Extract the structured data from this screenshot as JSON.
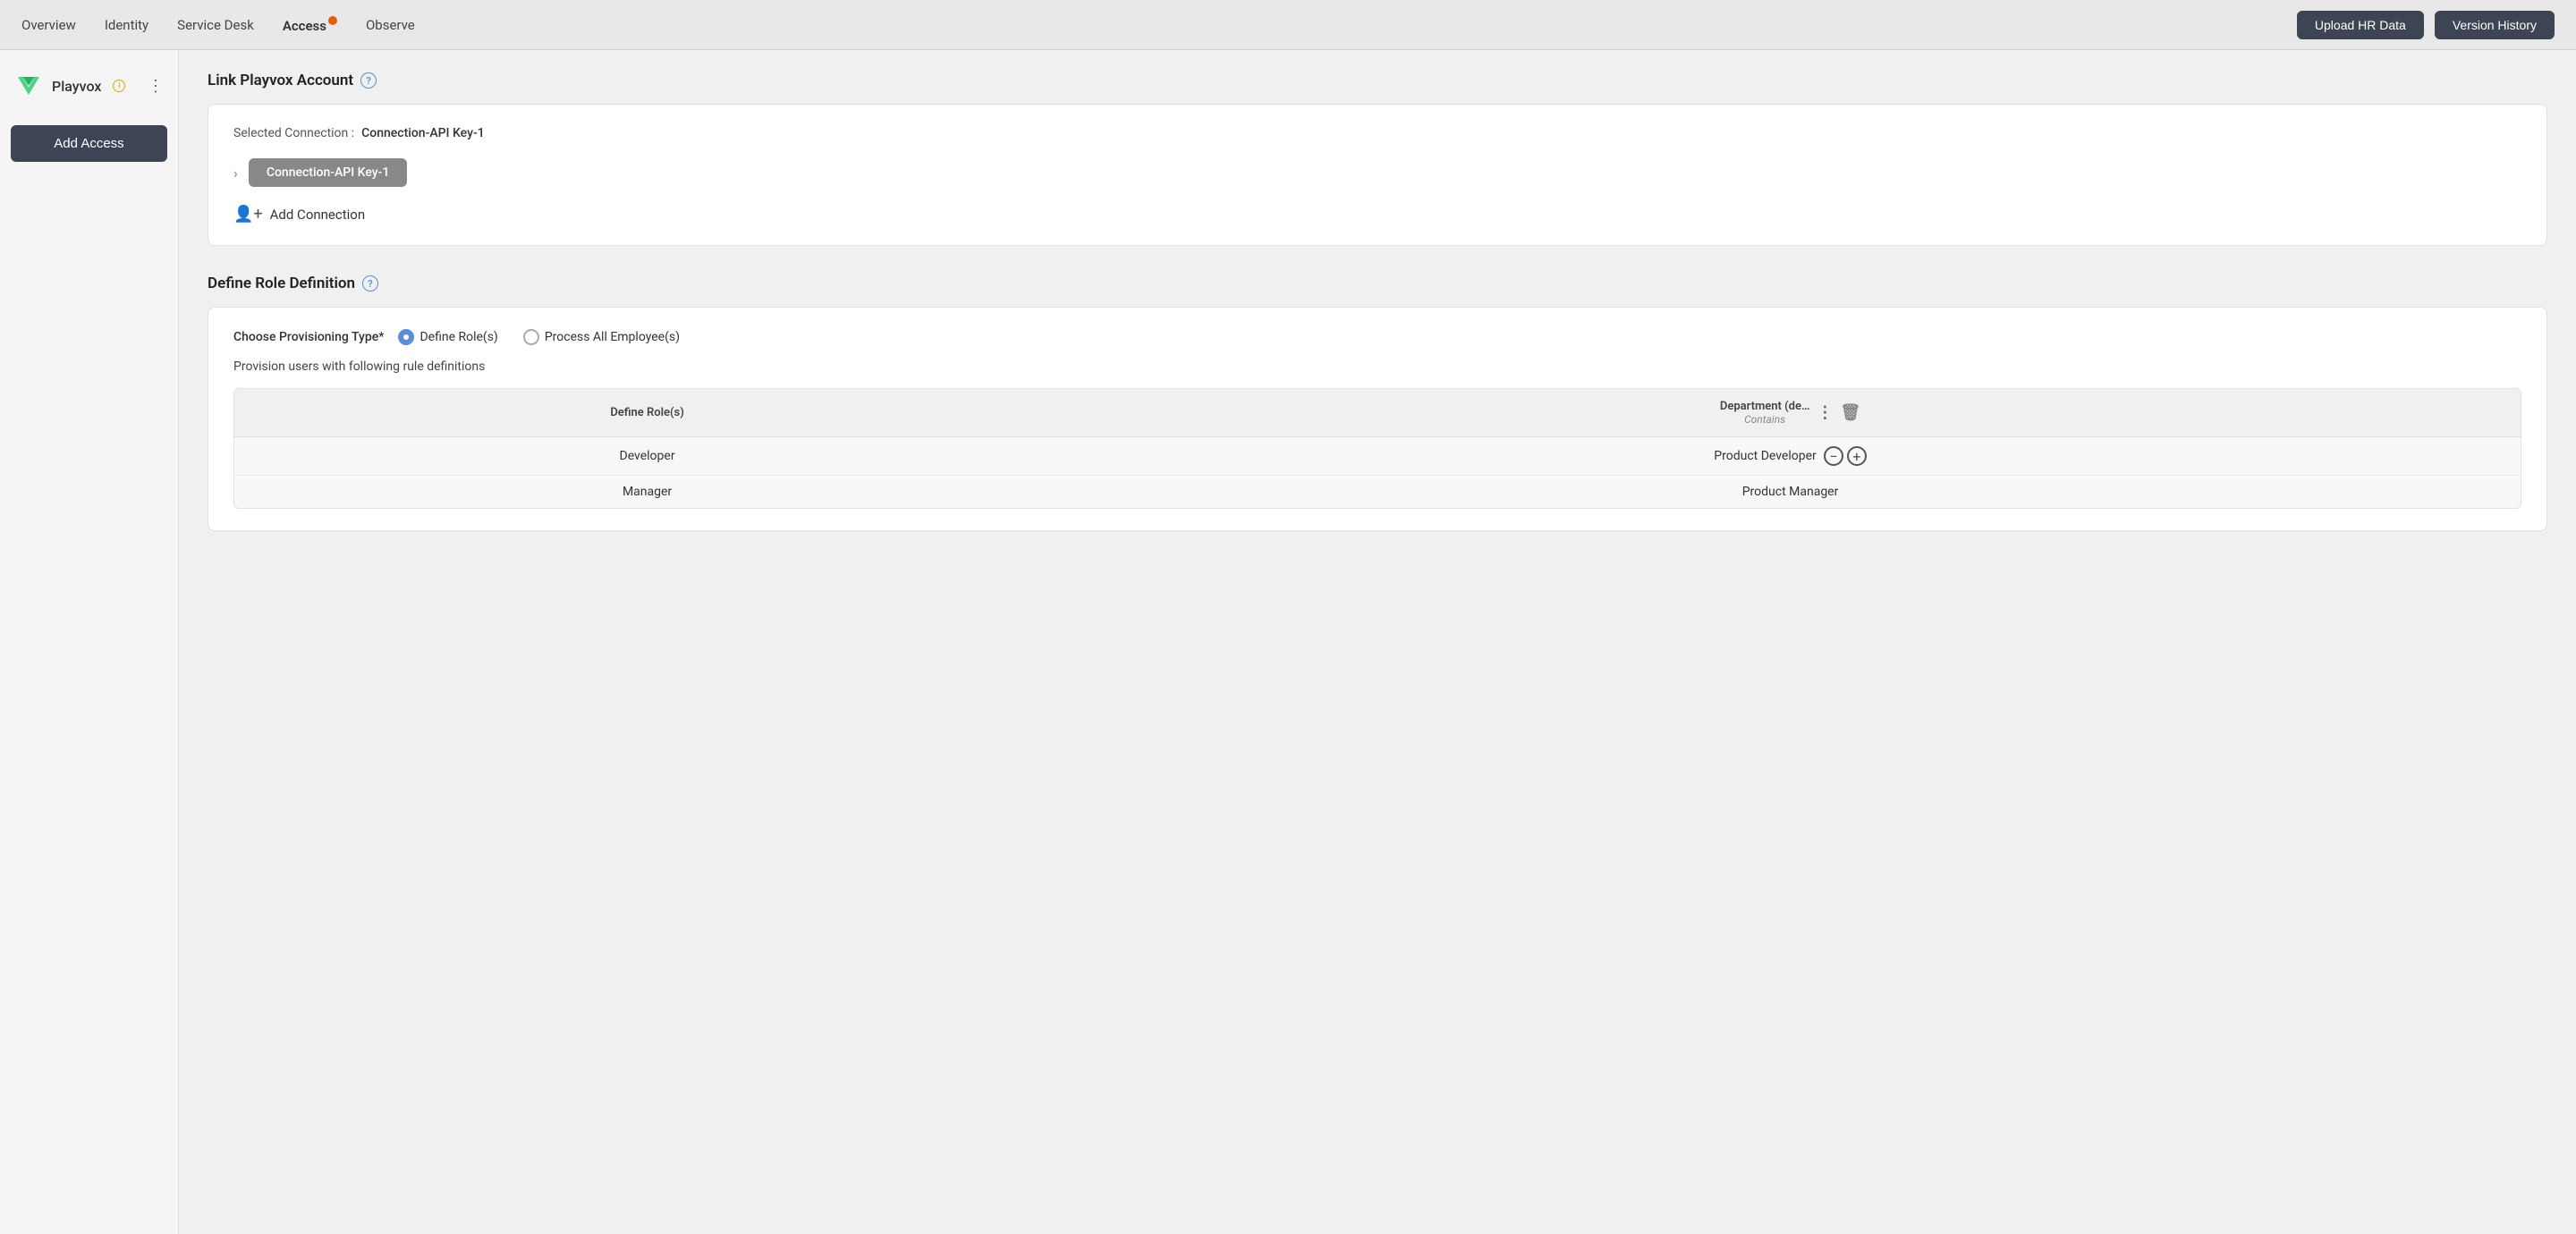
{
  "nav": {
    "items": [
      {
        "id": "overview",
        "label": "Overview",
        "active": false,
        "badge": false
      },
      {
        "id": "identity",
        "label": "Identity",
        "active": false,
        "badge": false
      },
      {
        "id": "service-desk",
        "label": "Service Desk",
        "active": false,
        "badge": false
      },
      {
        "id": "access",
        "label": "Access",
        "active": true,
        "badge": true
      },
      {
        "id": "observe",
        "label": "Observe",
        "active": false,
        "badge": false
      }
    ],
    "upload_hr_label": "Upload HR Data",
    "version_history_label": "Version History"
  },
  "sidebar": {
    "brand_name": "Playvox",
    "add_access_label": "Add Access"
  },
  "link_playvox": {
    "title": "Link Playvox Account",
    "selected_connection_label": "Selected Connection :",
    "selected_connection_value": "Connection-API Key-1",
    "connection_pill_label": "Connection-API Key-1",
    "add_connection_label": "Add Connection"
  },
  "define_role": {
    "title": "Define Role Definition",
    "provisioning_label": "Choose Provisioning Type*",
    "option1_label": "Define Role(s)",
    "option2_label": "Process All Employee(s)",
    "provision_subtitle": "Provision users with following rule definitions",
    "table": {
      "col1_header": "Define Role(s)",
      "col2_header": "Department (de…",
      "col2_sub": "Contains",
      "rows": [
        {
          "role": "Developer",
          "department": "Product Developer"
        },
        {
          "role": "Manager",
          "department": "Product Manager"
        }
      ]
    }
  }
}
